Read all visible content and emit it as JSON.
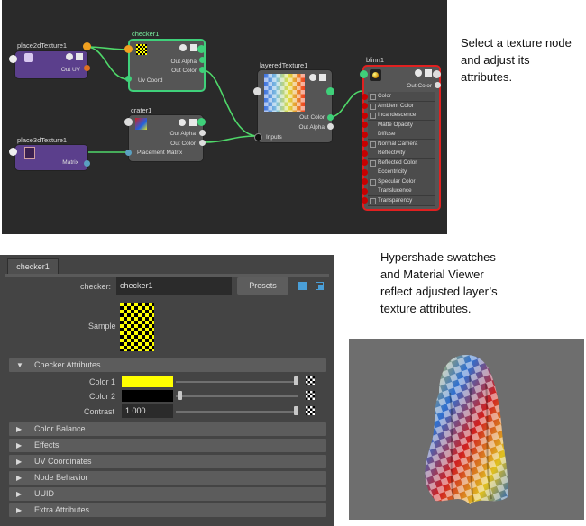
{
  "node_editor": {
    "nodes": {
      "place2d": {
        "title": "place2dTexture1",
        "out_label": "Out UV"
      },
      "checker": {
        "title": "checker1",
        "rows": [
          "Out Alpha",
          "Out Color",
          "Uv Coord"
        ]
      },
      "crater": {
        "title": "crater1",
        "rows": [
          "Out Alpha",
          "Out Color",
          "Placement Matrix"
        ]
      },
      "place3d": {
        "title": "place3dTexture1",
        "out_label": "Matrix"
      },
      "layered": {
        "title": "layeredTexture1",
        "rows": [
          "Out Color",
          "Out Alpha",
          "Inputs"
        ]
      },
      "blinn": {
        "title": "blinn1",
        "out_label": "Out Color",
        "attributes": [
          "Color",
          "Ambient Color",
          "Incandescence",
          "Matte Opacity",
          "Diffuse",
          "Normal Camera",
          "Reflectivity",
          "Reflected Color",
          "Eccentricity",
          "Specular Color",
          "Translucence",
          "Transparency"
        ]
      }
    },
    "colors": {
      "place_node": "#5b3f8c",
      "texture_node": "#555555",
      "selected_border": "#3fd07a",
      "blinn_border": "#e02020",
      "wire": "#4fd86a"
    }
  },
  "captions": {
    "top": [
      "Select a texture node",
      "and adjust its",
      "attributes."
    ],
    "bottom": [
      "Hypershade swatches",
      "and Material Viewer",
      "reflect adjusted layer’s",
      "texture attributes."
    ]
  },
  "attribute_editor": {
    "tab": "checker1",
    "name_label": "checker:",
    "name_value": "checker1",
    "presets_button": "Presets",
    "sample_label": "Sample",
    "checker_section": "Checker Attributes",
    "color1_label": "Color 1",
    "color1_value": "#ffff00",
    "color2_label": "Color 2",
    "color2_value": "#000000",
    "contrast_label": "Contrast",
    "contrast_value": "1.000",
    "collapsed_sections": [
      "Color Balance",
      "Effects",
      "UV Coordinates",
      "Node Behavior",
      "UUID",
      "Extra Attributes"
    ]
  },
  "icons": [
    "focus-icon",
    "copy-tab-icon",
    "map-button-icon",
    "expand-triangle-icon",
    "collapse-triangle-icon"
  ]
}
